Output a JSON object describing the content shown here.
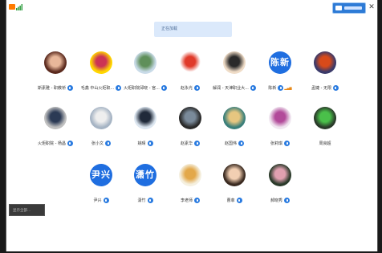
{
  "app": {
    "logo": "app-logo-icon",
    "signal": "signal-bars-icon"
  },
  "loading_text": "正在加载",
  "side_button": "显示全部...",
  "participants": [
    {
      "name": "斯素雅 - 职教桥",
      "avatar": {
        "kind": "photo",
        "bg": "#5b2a1e",
        "fg": "#e8b79a"
      },
      "mic": true,
      "sig": false
    },
    {
      "name": "毛鑫 中山火炬职...",
      "avatar": {
        "kind": "photo",
        "bg": "#ffd700",
        "fg": "#cc3355"
      },
      "mic": true,
      "sig": false
    },
    {
      "name": "火炬职院邱晓 - 官...",
      "avatar": {
        "kind": "photo",
        "bg": "#c9dbe8",
        "fg": "#5f8f5a"
      },
      "mic": true,
      "sig": false
    },
    {
      "name": "赵永光",
      "avatar": {
        "kind": "photo",
        "bg": "#ffffff",
        "fg": "#e03a2a"
      },
      "mic": true,
      "sig": false
    },
    {
      "name": "解润 - 天津职业大...",
      "avatar": {
        "kind": "photo",
        "bg": "#efdcc7",
        "fg": "#2a2a2a"
      },
      "mic": true,
      "sig": false
    },
    {
      "name": "陈新",
      "avatar": {
        "kind": "text",
        "text": "陈新"
      },
      "mic": true,
      "sig": true
    },
    {
      "name": "孟婕 - 无限",
      "avatar": {
        "kind": "photo",
        "bg": "#3a3a6a",
        "fg": "#d84a1a"
      },
      "mic": true,
      "sig": false
    },
    {
      "name": "火炬职院 - 杨昌",
      "avatar": {
        "kind": "photo",
        "bg": "#c0c0c0",
        "fg": "#2b3a55"
      },
      "mic": true,
      "sig": false
    },
    {
      "name": "张小文",
      "avatar": {
        "kind": "photo",
        "bg": "#a6b4c4",
        "fg": "#eeeeee"
      },
      "mic": true,
      "sig": false
    },
    {
      "name": "姚晴",
      "avatar": {
        "kind": "photo",
        "bg": "#dce6f0",
        "fg": "#202a3a"
      },
      "mic": true,
      "sig": false
    },
    {
      "name": "赵素华",
      "avatar": {
        "kind": "photo",
        "bg": "#2a2a2a",
        "fg": "#7a8a9a"
      },
      "mic": true,
      "sig": false
    },
    {
      "name": "赵国伟",
      "avatar": {
        "kind": "photo",
        "bg": "#3a7f7a",
        "fg": "#e6c680"
      },
      "mic": true,
      "sig": false
    },
    {
      "name": "张莉琪",
      "avatar": {
        "kind": "photo",
        "bg": "#f0e6f0",
        "fg": "#b24a9a"
      },
      "mic": true,
      "sig": false
    },
    {
      "name": "周良超",
      "avatar": {
        "kind": "photo",
        "bg": "#2a3a2a",
        "fg": "#4ac04a"
      },
      "mic": false,
      "sig": false
    },
    {
      "name": "尹兴",
      "avatar": {
        "kind": "text",
        "text": "尹兴"
      },
      "mic": true,
      "sig": false
    },
    {
      "name": "潇竹",
      "avatar": {
        "kind": "text",
        "text": "潇竹"
      },
      "mic": true,
      "sig": false
    },
    {
      "name": "李老师",
      "avatar": {
        "kind": "photo",
        "bg": "#f5f0e0",
        "fg": "#e3a84a"
      },
      "mic": true,
      "sig": false
    },
    {
      "name": "曹菲",
      "avatar": {
        "kind": "photo",
        "bg": "#3a2a20",
        "fg": "#f2cfb2"
      },
      "mic": true,
      "sig": false
    },
    {
      "name": "郝晓秀",
      "avatar": {
        "kind": "photo",
        "bg": "#2a3a2a",
        "fg": "#e0a0b0"
      },
      "mic": true,
      "sig": false
    }
  ],
  "colors": {
    "accent": "#2a7be0",
    "loading_bg": "#dbe9fb"
  }
}
